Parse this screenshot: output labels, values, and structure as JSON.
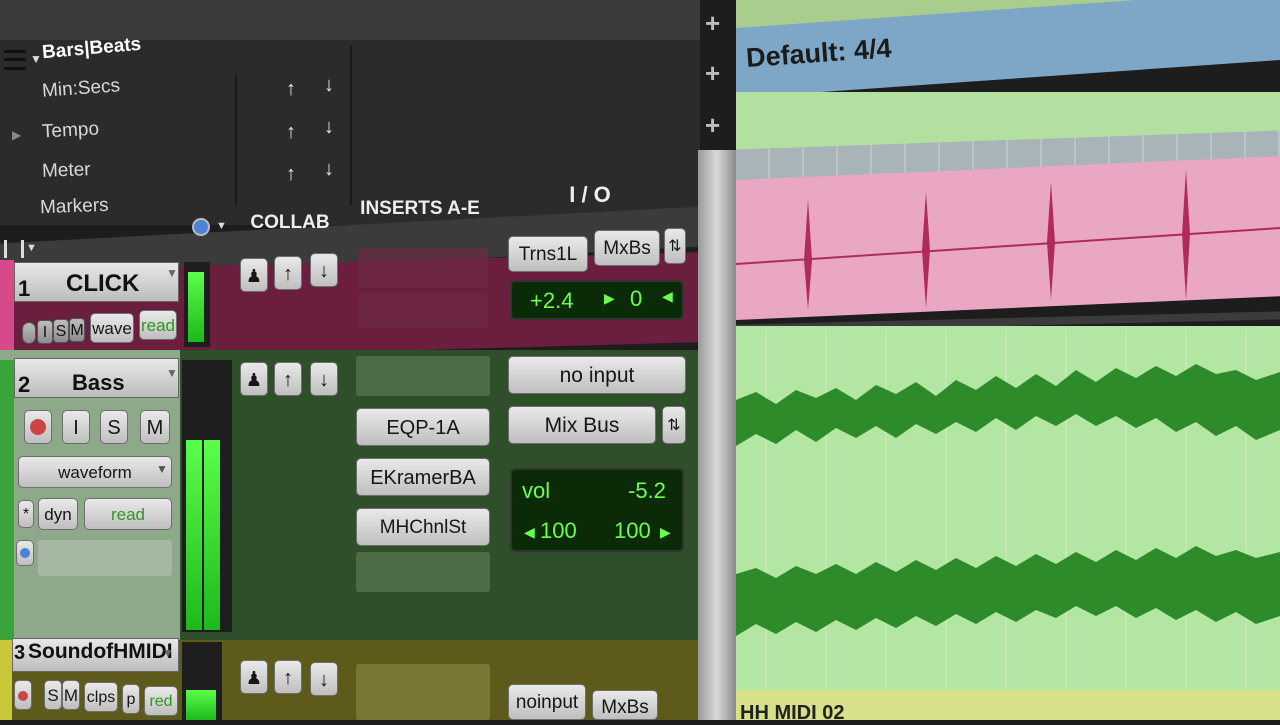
{
  "rulers": {
    "primary": "Bars|Beats",
    "items": [
      "Min:Secs",
      "Tempo",
      "Meter",
      "Markers"
    ]
  },
  "timeline": {
    "meter_label": "Default: 4/4"
  },
  "mix_header": {
    "collab": "COLLAB",
    "inserts": "INSERTS A-E",
    "io": "I / O"
  },
  "tracks": [
    {
      "number": "1",
      "name": "CLICK",
      "buttons": {
        "input": "I",
        "solo": "S",
        "mute": "M"
      },
      "view": "wave",
      "automation": "read",
      "io": {
        "input": "Trns1L",
        "output": "MxBs",
        "volume": "+2.4",
        "pan": "0"
      },
      "color": "#d64a8a"
    },
    {
      "number": "2",
      "name": "Bass",
      "buttons": {
        "input": "I",
        "solo": "S",
        "mute": "M"
      },
      "view": "waveform",
      "dyn": "dyn",
      "automation": "read",
      "inserts": [
        "EQP-1A",
        "EKramerBA",
        "MHChnlSt"
      ],
      "io": {
        "input": "no input",
        "output": "Mix Bus",
        "vol_label": "vol",
        "volume": "-5.2",
        "pan_left": "100",
        "pan_right": "100"
      },
      "color": "#3aa43a"
    },
    {
      "number": "3",
      "name": "SoundofHMIDI",
      "buttons": {
        "solo": "S",
        "mute": "M"
      },
      "view": "clps",
      "view2": "p",
      "automation": "red",
      "io": {
        "input": "noinput",
        "output": "MxBs"
      },
      "clip_label": "HH MIDI 02",
      "color": "#c9c83a"
    }
  ]
}
